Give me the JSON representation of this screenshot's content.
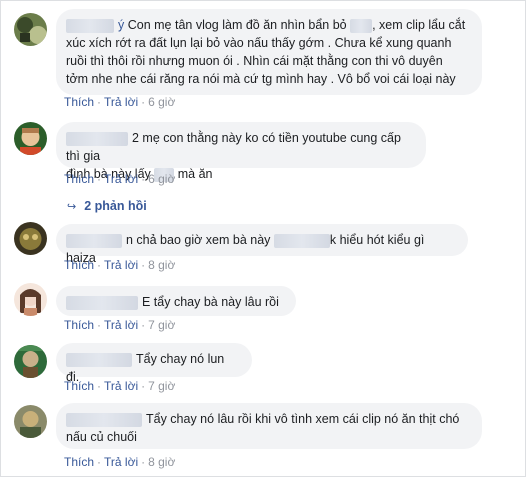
{
  "comments": [
    {
      "avatar_colors": [
        "#3b4a2a",
        "#6b7d4a",
        "#b9c08e"
      ],
      "name_suffix": "ý",
      "text_lines": [
        [
          "Con mẹ tân vlog làm đồ ăn nhìn bẩn bỏ ",
          "...",
          ", xem clip lẩu cắt"
        ],
        [
          "xúc xích rớt ra đất lụn lại bỏ vào nấu thấy gớm . Chưa kể xung quanh"
        ],
        [
          "ruồi thì thôi rồi nhưng muon ói . Nhìn cái mặt thằng con thi vô duyên"
        ],
        [
          "tởm nhe nhe cái răng ra nói mà cứ tg mình hay . Vô bổ voi cái loại này"
        ]
      ],
      "like": "Thích",
      "reply": "Trả lời",
      "time": "6 giờ"
    },
    {
      "avatar_colors": [
        "#e8c49a",
        "#b07a4c",
        "#2c5e2a"
      ],
      "name_prefix": "...... Hiệp",
      "text_lines": [
        [
          "2 mẹ con thằng này ko có tiền youtube cung cấp thì gia"
        ],
        [
          "đình bà này lấy ",
          "",
          " mà ăn"
        ]
      ],
      "like": "Thích",
      "reply": "Trả lời",
      "time": "6 giờ"
    },
    {
      "avatar_colors": [
        "#3a3320",
        "#8a7a3a",
        "#d8c27a"
      ],
      "text_lines": [
        [
          "",
          "n chả bao giờ xem bà này ",
          "",
          "k hiểu hót kiểu gì haiza"
        ]
      ],
      "like": "Thích",
      "reply": "Trả lời",
      "time": "8 giờ"
    },
    {
      "avatar_colors": [
        "#f0d6c8",
        "#c98a6a",
        "#5a3a2a"
      ],
      "text_lines": [
        [
          "",
          "E tẩy chay bà này lâu rồi"
        ]
      ],
      "like": "Thích",
      "reply": "Trả lời",
      "time": "7 giờ"
    },
    {
      "avatar_colors": [
        "#c9b08a",
        "#6a5030",
        "#2e6a3a"
      ],
      "text_lines": [
        [
          "",
          "Tẩy chay nó lun đi."
        ]
      ],
      "like": "Thích",
      "reply": "Trả lời",
      "time": "7 giờ"
    },
    {
      "avatar_colors": [
        "#8a8a6a",
        "#c8b07a",
        "#4a5a3a"
      ],
      "text_lines": [
        [
          "",
          "Tẩy chay nó lâu rồi khi vô tình xem cái clip nó ăn thịt chó"
        ],
        [
          "nấu củ chuối"
        ]
      ],
      "like": "Thích",
      "reply": "Trả lời",
      "time": "8 giờ"
    }
  ],
  "replies_link": {
    "label": "2 phản hồi",
    "icon": "reply-arrow-icon"
  },
  "colors": {
    "link": "#385898",
    "bubble": "#f2f3f5",
    "meta": "#90949c"
  }
}
